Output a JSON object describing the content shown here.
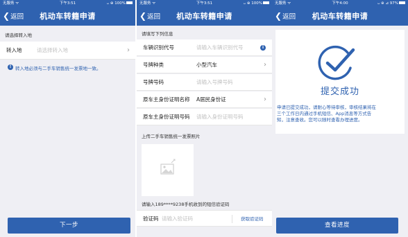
{
  "screens": [
    {
      "status": {
        "carrier": "无服务 ᯤ",
        "time": "下午3:51",
        "right": "ᴗ ⊕ 100%"
      },
      "nav": {
        "back_label": "返回",
        "title": "机动车转籍申请"
      },
      "section_label": "请选择转入地",
      "fields": [
        {
          "label": "转入地",
          "placeholder": "请选择转入地"
        }
      ],
      "notice": "转入地必须与二手车销售统一发票地一致。",
      "button": "下一步"
    },
    {
      "status": {
        "carrier": "无服务 ᯤ",
        "time": "下午3:51",
        "right": "ᴗ ⊕ 100%"
      },
      "nav": {
        "back_label": "返回",
        "title": "机动车转籍申请"
      },
      "section_label": "请填写下列信息",
      "fields": [
        {
          "label": "车辆识别代号",
          "placeholder": "请输入车辆识别代号"
        },
        {
          "label": "号牌种类",
          "value": "小型汽车"
        },
        {
          "label": "号牌号码",
          "placeholder": "请输入号牌号码"
        },
        {
          "label": "原车主身份证明名称",
          "value": "A居民身份证"
        },
        {
          "label": "原车主身份证明号码",
          "placeholder": "请输入身份证明号码"
        }
      ],
      "upload_label": "上传二手车销售统一发票照片",
      "sms_hint": "请输入189****9238手机收到的短信验证码",
      "code": {
        "label": "验证码",
        "placeholder": "请输入验证码",
        "action": "获取验证码"
      }
    },
    {
      "status": {
        "carrier": "无服务 ᯤ",
        "time": "下午4:00",
        "right": "ᴗ ⊕ ⊿ 97%"
      },
      "nav": {
        "back_label": "返回",
        "title": "机动车转籍申请"
      },
      "success_title": "提交成功",
      "message_lines": [
        "申请已提交成功，请耐心等待审核，审核结果将在",
        "三个工作日内通过手机短信、App消息等方式告",
        "知，注意查收。您可以随时查看办理进度。"
      ],
      "button": "查看进度"
    }
  ],
  "colors": {
    "brand": "#2f62b0",
    "background": "#efeff4",
    "placeholder": "#c2c2c2"
  },
  "icons": [
    "back-chevron-icon",
    "chevron-right-icon",
    "info-icon",
    "image-placeholder-icon",
    "checkmark-circle-icon"
  ]
}
